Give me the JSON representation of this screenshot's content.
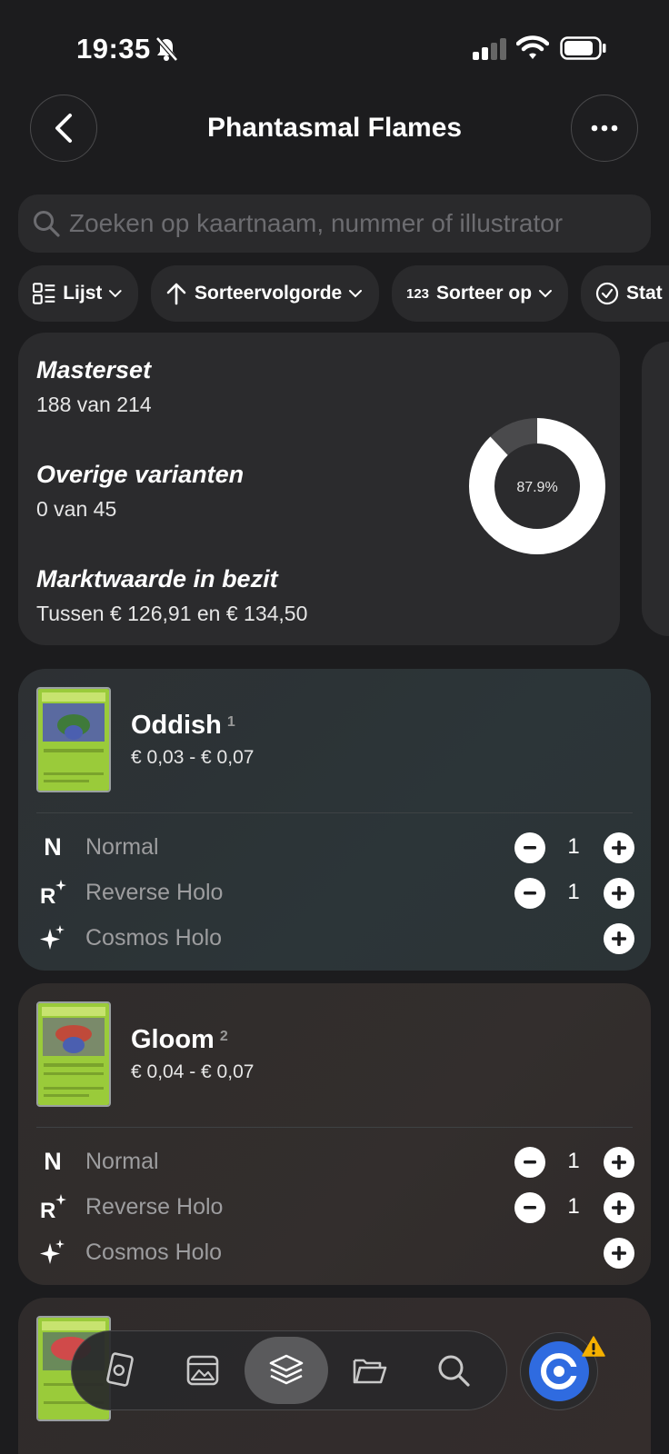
{
  "status": {
    "time": "19:35"
  },
  "header": {
    "title": "Phantasmal Flames"
  },
  "search": {
    "placeholder": "Zoeken op kaartnaam, nummer of illustrator"
  },
  "chips": [
    {
      "label": "Lijst"
    },
    {
      "label": "Sorteervolgorde"
    },
    {
      "prefix": "123",
      "label": "Sorteer op"
    },
    {
      "label": "Stat"
    }
  ],
  "stats": {
    "masterset_label": "Masterset",
    "masterset_value": "188 van 214",
    "variants_label": "Overige varianten",
    "variants_value": "0 van 45",
    "market_label": "Marktwaarde in bezit",
    "market_value": "Tussen € 126,91 en € 134,50",
    "percent_text": "87.9%",
    "percent": 0.879
  },
  "cards": [
    {
      "name": "Oddish",
      "number": "1",
      "price": "€ 0,03 - € 0,07",
      "variants": [
        {
          "icon": "N",
          "label": "Normal",
          "qty": "1"
        },
        {
          "icon": "R",
          "label": "Reverse Holo",
          "qty": "1"
        },
        {
          "icon": "sparkle",
          "label": "Cosmos Holo"
        }
      ]
    },
    {
      "name": "Gloom",
      "number": "2",
      "price": "€ 0,04 - € 0,07",
      "variants": [
        {
          "icon": "N",
          "label": "Normal",
          "qty": "1"
        },
        {
          "icon": "R",
          "label": "Reverse Holo",
          "qty": "1"
        },
        {
          "icon": "sparkle",
          "label": "Cosmos Holo"
        }
      ]
    }
  ],
  "tabs": [
    "pokedex-icon",
    "cards-icon",
    "layers-icon",
    "folder-icon",
    "search-icon"
  ],
  "colors": {
    "background": "#1c1c1e",
    "card": "#2b2b2d",
    "accent": "#2f6be0",
    "warning": "#f5b000"
  }
}
